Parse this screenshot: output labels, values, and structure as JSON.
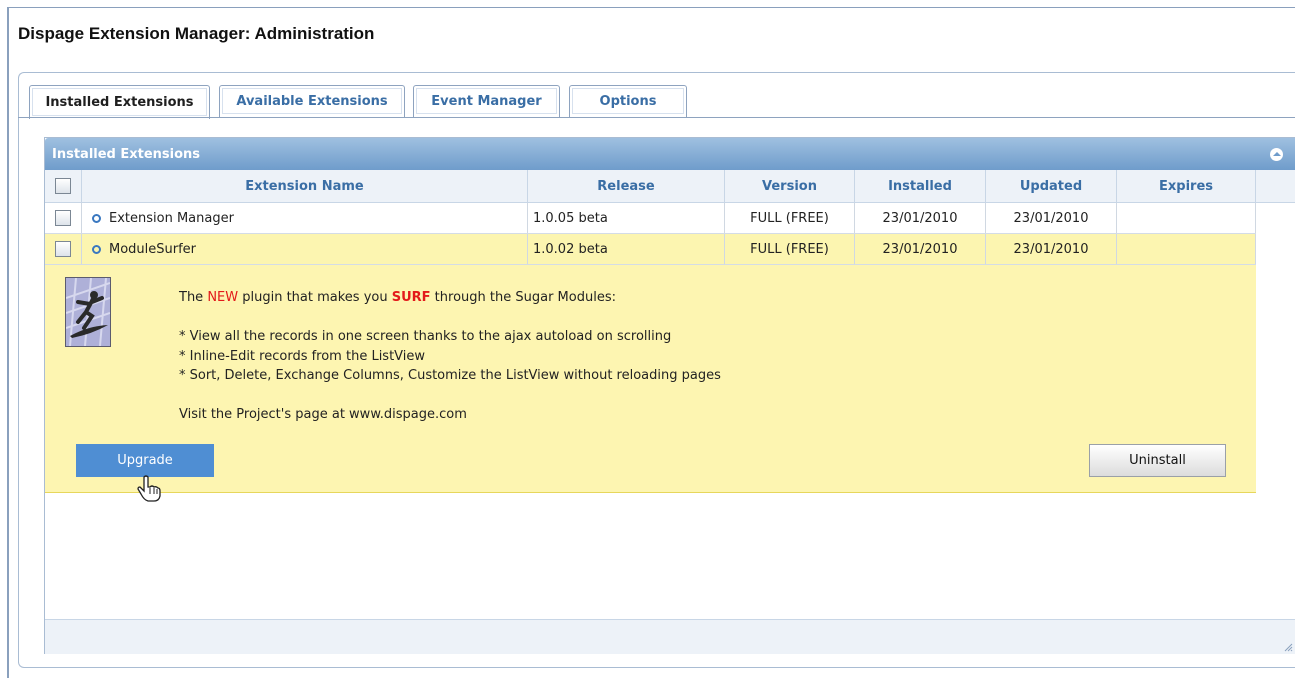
{
  "page": {
    "title": "Dispage Extension Manager: Administration"
  },
  "tabs": [
    {
      "label": "Installed Extensions",
      "active": true
    },
    {
      "label": "Available Extensions",
      "active": false
    },
    {
      "label": "Event Manager",
      "active": false
    },
    {
      "label": "Options",
      "active": false
    }
  ],
  "panel": {
    "title": "Installed Extensions"
  },
  "table": {
    "columns": [
      "Extension Name",
      "Release",
      "Version",
      "Installed",
      "Updated",
      "Expires"
    ],
    "rows": [
      {
        "name": "Extension Manager",
        "release": "1.0.05 beta",
        "version": "FULL (FREE)",
        "installed": "23/01/2010",
        "updated": "23/01/2010",
        "expires": ""
      },
      {
        "name": "ModuleSurfer",
        "release": "1.0.02 beta",
        "version": "FULL (FREE)",
        "installed": "23/01/2010",
        "updated": "23/01/2010",
        "expires": ""
      }
    ]
  },
  "detail": {
    "intro_1": "The ",
    "intro_new": "NEW",
    "intro_2": " plugin that makes you ",
    "intro_surf": "SURF",
    "intro_3": " through the Sugar Modules:",
    "features": [
      "* View all the records in one screen thanks to the ajax autoload on scrolling",
      "* Inline-Edit records from the ListView",
      "* Sort, Delete, Exchange Columns, Customize the ListView without reloading pages"
    ],
    "visit": "Visit the Project's page at www.dispage.com",
    "upgrade_label": "Upgrade",
    "uninstall_label": "Uninstall"
  },
  "icons": {
    "collapse": "collapse-icon",
    "bullet": "bullet-icon",
    "thumbnail": "surfer-thumbnail",
    "cursor": "hand-cursor-icon",
    "resize": "resize-grip-icon"
  },
  "colors": {
    "tab_text": "#3a6ea5",
    "header": "#6f9ccb",
    "highlight": "#fcf5b0",
    "upgrade": "#4f8ed3",
    "accent_red": "#e31a1a"
  }
}
